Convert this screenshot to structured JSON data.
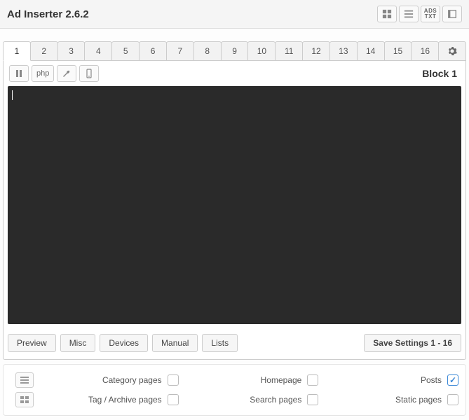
{
  "header": {
    "title": "Ad Inserter 2.6.2"
  },
  "tabs": [
    "1",
    "2",
    "3",
    "4",
    "5",
    "6",
    "7",
    "8",
    "9",
    "10",
    "11",
    "12",
    "13",
    "14",
    "15",
    "16"
  ],
  "active_tab": 0,
  "toolbar": {
    "php_label": "php",
    "block_label": "Block 1"
  },
  "buttons": {
    "preview": "Preview",
    "misc": "Misc",
    "devices": "Devices",
    "manual": "Manual",
    "lists": "Lists",
    "save": "Save Settings 1 - 16"
  },
  "options": {
    "row1": [
      {
        "label": "Category pages",
        "checked": false
      },
      {
        "label": "Homepage",
        "checked": false
      },
      {
        "label": "Posts",
        "checked": true
      }
    ],
    "row2": [
      {
        "label": "Tag / Archive pages",
        "checked": false
      },
      {
        "label": "Search pages",
        "checked": false
      },
      {
        "label": "Static pages",
        "checked": false
      }
    ]
  }
}
